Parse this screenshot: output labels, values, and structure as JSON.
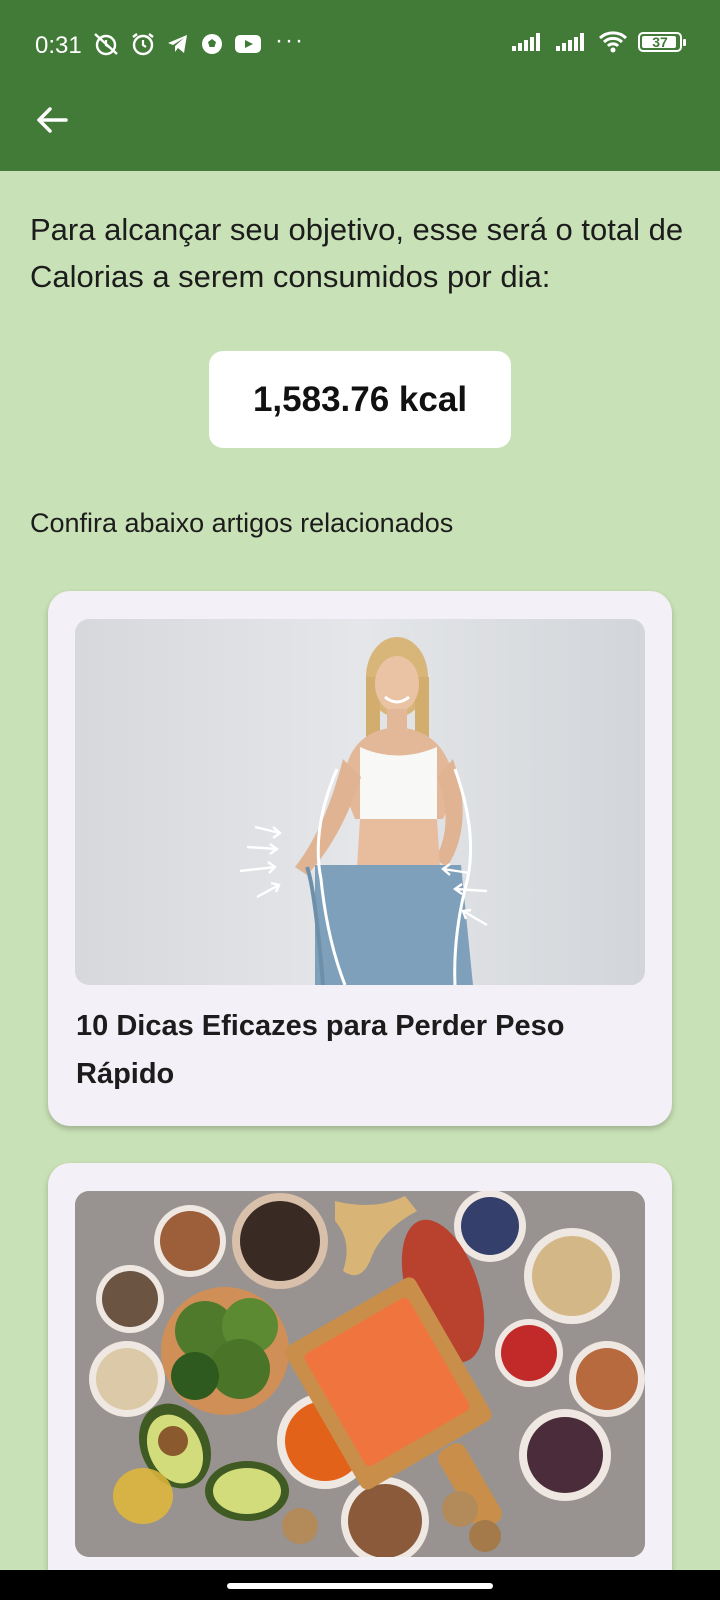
{
  "status_bar": {
    "time": "0:31",
    "battery": "37",
    "left_icons": [
      "alarm-off-icon",
      "alarm-icon",
      "telegram-icon",
      "soccer-ball-icon",
      "youtube-icon"
    ],
    "overflow": "···",
    "right_icons": [
      "signal-1-icon",
      "signal-2-icon",
      "wifi-icon",
      "battery-icon"
    ]
  },
  "app_bar": {
    "back_icon": "arrow-left-icon",
    "color": "#427a37"
  },
  "content": {
    "intro_text": "Para alcançar seu objetivo, esse será o total de Calorias a serem consumidos por dia:",
    "calories": "1,583.76 kcal",
    "related_heading": "Confira abaixo artigos relacionados"
  },
  "articles": [
    {
      "title": "10 Dicas Eficazes para Perder Peso Rápido",
      "image": "woman-weight-loss-photo"
    },
    {
      "title": "",
      "image": "healthy-food-bowls-photo"
    }
  ],
  "colors": {
    "background": "#c9e1b6",
    "card": "#f4f0f7",
    "accent": "#427a37"
  }
}
